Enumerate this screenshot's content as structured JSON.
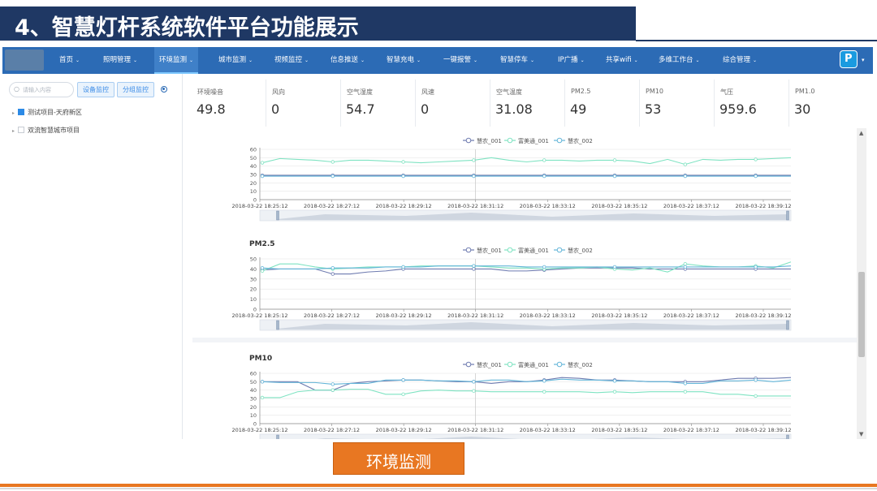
{
  "slide": {
    "title": "4、智慧灯杆系统软件平台功能展示",
    "footer_label": "环境监测"
  },
  "nav": {
    "items": [
      {
        "label": "首页"
      },
      {
        "label": "照明管理"
      },
      {
        "label": "环境监测",
        "active": true
      },
      {
        "label": "城市监测"
      },
      {
        "label": "视频监控"
      },
      {
        "label": "信息推送"
      },
      {
        "label": "智慧充电"
      },
      {
        "label": "一键报警"
      },
      {
        "label": "智慧停车"
      },
      {
        "label": "IP广播"
      },
      {
        "label": "共享wifi"
      },
      {
        "label": "多维工作台"
      },
      {
        "label": "综合管理"
      }
    ],
    "logo_letter": "P"
  },
  "sidebar": {
    "search_placeholder": "请输入内容",
    "btn_device": "设备监控",
    "btn_group": "分组监控",
    "tree": [
      {
        "label": "测试项目-天府新区",
        "checked": true
      },
      {
        "label": "双流智慧城市项目",
        "checked": false
      }
    ]
  },
  "metrics": [
    {
      "label": "环境噪音",
      "value": "49.8"
    },
    {
      "label": "风向",
      "value": "0"
    },
    {
      "label": "空气湿度",
      "value": "54.7"
    },
    {
      "label": "风速",
      "value": "0"
    },
    {
      "label": "空气温度",
      "value": "31.08"
    },
    {
      "label": "PM2.5",
      "value": "49"
    },
    {
      "label": "PM10",
      "value": "53"
    },
    {
      "label": "气压",
      "value": "959.6"
    },
    {
      "label": "PM1.0",
      "value": "30"
    }
  ],
  "colors": {
    "series": [
      "#6e7bb0",
      "#7fe3c2",
      "#63b5d8"
    ],
    "nav": "#2c6bb5",
    "title_bar": "#1f3864",
    "accent_orange": "#e87722"
  },
  "chart_data": [
    {
      "type": "line",
      "title": "",
      "legend": [
        "慧农_001",
        "富美通_001",
        "慧农_002"
      ],
      "x": [
        "2018-03-22 18:25:12",
        "2018-03-22 18:27:12",
        "2018-03-22 18:29:12",
        "2018-03-22 18:31:12",
        "2018-03-22 18:33:12",
        "2018-03-22 18:35:12",
        "2018-03-22 18:37:12",
        "2018-03-22 18:39:12"
      ],
      "ylim": [
        0,
        60
      ],
      "yticks": [
        0,
        10,
        20,
        30,
        40,
        50,
        60
      ],
      "series": [
        {
          "name": "慧农_001",
          "values": [
            29,
            29,
            29,
            29,
            29,
            29,
            29,
            29,
            29,
            29,
            29,
            29,
            29,
            29,
            29,
            29,
            29,
            29,
            29,
            29,
            29,
            29,
            29,
            29,
            29,
            29,
            29,
            29,
            29,
            29,
            29
          ]
        },
        {
          "name": "富美通_001",
          "values": [
            44,
            49,
            48,
            47,
            45,
            47,
            47,
            46,
            45,
            44,
            45,
            46,
            47,
            50,
            47,
            45,
            47,
            47,
            46,
            47,
            47,
            46,
            43,
            48,
            42,
            48,
            47,
            48,
            48,
            49,
            50
          ]
        },
        {
          "name": "慧农_002",
          "values": [
            28,
            28,
            28,
            28,
            28,
            28,
            28,
            28,
            28,
            28,
            28,
            28,
            28,
            28,
            28,
            28,
            28,
            28,
            28,
            28,
            28,
            28,
            28,
            28,
            28,
            28,
            28,
            28,
            28,
            28,
            28
          ]
        }
      ]
    },
    {
      "type": "line",
      "title": "PM2.5",
      "legend": [
        "慧农_001",
        "富美通_001",
        "慧农_002"
      ],
      "x": [
        "2018-03-22 18:25:12",
        "2018-03-22 18:27:12",
        "2018-03-22 18:29:12",
        "2018-03-22 18:31:12",
        "2018-03-22 18:33:12",
        "2018-03-22 18:35:12",
        "2018-03-22 18:37:12",
        "2018-03-22 18:39:12"
      ],
      "ylim": [
        0,
        50
      ],
      "yticks": [
        0,
        10,
        20,
        30,
        40,
        50
      ],
      "series": [
        {
          "name": "慧农_001",
          "values": [
            39,
            40,
            40,
            40,
            35,
            35,
            37,
            38,
            40,
            40,
            40,
            40,
            40,
            40,
            38,
            38,
            39,
            40,
            41,
            41,
            41,
            41,
            40,
            40,
            40,
            40,
            40,
            40,
            40,
            40,
            40
          ]
        },
        {
          "name": "富美通_001",
          "values": [
            38,
            45,
            45,
            42,
            40,
            41,
            42,
            42,
            42,
            43,
            43,
            43,
            43,
            42,
            41,
            41,
            40,
            41,
            41,
            42,
            40,
            39,
            41,
            37,
            45,
            43,
            42,
            42,
            43,
            41,
            47
          ]
        },
        {
          "name": "慧农_002",
          "values": [
            41,
            40,
            40,
            40,
            41,
            41,
            41,
            42,
            42,
            42,
            43,
            43,
            43,
            43,
            43,
            42,
            42,
            42,
            42,
            42,
            42,
            42,
            42,
            42,
            42,
            42,
            42,
            42,
            42,
            42,
            43
          ]
        }
      ]
    },
    {
      "type": "line",
      "title": "PM10",
      "legend": [
        "慧农_001",
        "富美通_001",
        "慧农_002"
      ],
      "x": [
        "2018-03-22 18:25:12",
        "2018-03-22 18:27:12",
        "2018-03-22 18:29:12",
        "2018-03-22 18:31:12",
        "2018-03-22 18:33:12",
        "2018-03-22 18:35:12",
        "2018-03-22 18:37:12",
        "2018-03-22 18:39:12"
      ],
      "ylim": [
        0,
        60
      ],
      "yticks": [
        0,
        10,
        20,
        30,
        40,
        50,
        60
      ],
      "series": [
        {
          "name": "慧农_001",
          "values": [
            50,
            50,
            50,
            40,
            40,
            48,
            50,
            51,
            52,
            52,
            51,
            50,
            50,
            48,
            50,
            50,
            52,
            55,
            54,
            52,
            52,
            51,
            50,
            50,
            50,
            50,
            52,
            54,
            54,
            54,
            55
          ]
        },
        {
          "name": "富美通_001",
          "values": [
            31,
            31,
            38,
            40,
            40,
            41,
            41,
            35,
            35,
            39,
            40,
            39,
            39,
            38,
            38,
            38,
            38,
            38,
            38,
            37,
            38,
            37,
            38,
            38,
            38,
            38,
            35,
            35,
            33,
            33,
            33
          ]
        },
        {
          "name": "慧农_002",
          "values": [
            50,
            49,
            49,
            49,
            47,
            48,
            48,
            52,
            52,
            52,
            51,
            51,
            50,
            52,
            52,
            50,
            51,
            53,
            52,
            52,
            51,
            51,
            50,
            50,
            48,
            48,
            51,
            51,
            52,
            50,
            52
          ]
        }
      ]
    }
  ]
}
